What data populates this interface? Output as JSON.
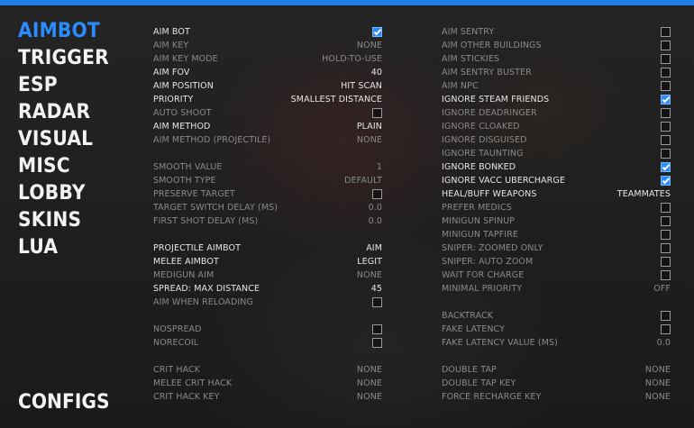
{
  "colors": {
    "accent": "#2a8cff",
    "topbar": "#1e7fe6"
  },
  "nav": {
    "items": [
      {
        "label": "AIMBOT",
        "active": true
      },
      {
        "label": "TRIGGER"
      },
      {
        "label": "ESP"
      },
      {
        "label": "RADAR"
      },
      {
        "label": "VISUAL"
      },
      {
        "label": "MISC"
      },
      {
        "label": "LOBBY"
      },
      {
        "label": "SKINS"
      },
      {
        "label": "LUA"
      }
    ],
    "configs_label": "CONFIGS"
  },
  "left": {
    "rows": [
      {
        "label": "AIM BOT",
        "type": "checkbox",
        "checked": true,
        "on": true
      },
      {
        "label": "AIM KEY",
        "type": "value",
        "value": "NONE"
      },
      {
        "label": "AIM KEY MODE",
        "type": "value",
        "value": "HOLD-TO-USE"
      },
      {
        "label": "AIM FOV",
        "type": "value",
        "value": "40",
        "on": true
      },
      {
        "label": "AIM POSITION",
        "type": "value",
        "value": "HIT SCAN",
        "on": true
      },
      {
        "label": "PRIORITY",
        "type": "value",
        "value": "SMALLEST DISTANCE",
        "on": true
      },
      {
        "label": "AUTO SHOOT",
        "type": "checkbox",
        "checked": false
      },
      {
        "label": "AIM METHOD",
        "type": "value",
        "value": "PLAIN",
        "on": true
      },
      {
        "label": "AIM METHOD (PROJECTILE)",
        "type": "value",
        "value": "NONE"
      },
      {
        "type": "gap"
      },
      {
        "label": "SMOOTH VALUE",
        "type": "value",
        "value": "1"
      },
      {
        "label": "SMOOTH TYPE",
        "type": "value",
        "value": "DEFAULT"
      },
      {
        "label": "PRESERVE TARGET",
        "type": "checkbox",
        "checked": false
      },
      {
        "label": "TARGET SWITCH DELAY (MS)",
        "type": "value",
        "value": "0.0"
      },
      {
        "label": "FIRST SHOT DELAY (MS)",
        "type": "value",
        "value": "0.0"
      },
      {
        "type": "gap"
      },
      {
        "label": "PROJECTILE AIMBOT",
        "type": "value",
        "value": "AIM",
        "on": true
      },
      {
        "label": "MELEE AIMBOT",
        "type": "value",
        "value": "LEGIT",
        "on": true
      },
      {
        "label": "MEDIGUN AIM",
        "type": "value",
        "value": "NONE"
      },
      {
        "label": "SPREAD: MAX DISTANCE",
        "type": "value",
        "value": "45",
        "on": true
      },
      {
        "label": "AIM WHEN RELOADING",
        "type": "checkbox",
        "checked": false
      },
      {
        "type": "gap"
      },
      {
        "label": "NOSPREAD",
        "type": "checkbox",
        "checked": false
      },
      {
        "label": "NORECOIL",
        "type": "checkbox",
        "checked": false
      },
      {
        "type": "gap"
      },
      {
        "label": "CRIT HACK",
        "type": "value",
        "value": "NONE"
      },
      {
        "label": "MELEE CRIT HACK",
        "type": "value",
        "value": "NONE"
      },
      {
        "label": "CRIT HACK KEY",
        "type": "value",
        "value": "NONE"
      }
    ]
  },
  "right": {
    "rows": [
      {
        "label": "AIM SENTRY",
        "type": "checkbox",
        "checked": false
      },
      {
        "label": "AIM OTHER BUILDINGS",
        "type": "checkbox",
        "checked": false
      },
      {
        "label": "AIM STICKIES",
        "type": "checkbox",
        "checked": false
      },
      {
        "label": "AIM SENTRY BUSTER",
        "type": "checkbox",
        "checked": false
      },
      {
        "label": "AIM NPC",
        "type": "checkbox",
        "checked": false
      },
      {
        "label": "IGNORE STEAM FRIENDS",
        "type": "checkbox",
        "checked": true,
        "on": true
      },
      {
        "label": "IGNORE DEADRINGER",
        "type": "checkbox",
        "checked": false
      },
      {
        "label": "IGNORE CLOAKED",
        "type": "checkbox",
        "checked": false
      },
      {
        "label": "IGNORE DISGUISED",
        "type": "checkbox",
        "checked": false
      },
      {
        "label": "IGNORE TAUNTING",
        "type": "checkbox",
        "checked": false
      },
      {
        "label": "IGNORE BONKED",
        "type": "checkbox",
        "checked": true,
        "on": true
      },
      {
        "label": "IGNORE VACC UBERCHARGE",
        "type": "checkbox",
        "checked": true,
        "on": true
      },
      {
        "label": "HEAL/BUFF WEAPONS",
        "type": "value",
        "value": "TEAMMATES",
        "on": true
      },
      {
        "label": "PREFER MEDICS",
        "type": "checkbox",
        "checked": false
      },
      {
        "label": "MINIGUN SPINUP",
        "type": "checkbox",
        "checked": false
      },
      {
        "label": "MINIGUN TAPFIRE",
        "type": "checkbox",
        "checked": false
      },
      {
        "label": "SNIPER: ZOOMED ONLY",
        "type": "checkbox",
        "checked": false
      },
      {
        "label": "SNIPER: AUTO ZOOM",
        "type": "checkbox",
        "checked": false
      },
      {
        "label": "WAIT FOR CHARGE",
        "type": "checkbox",
        "checked": false
      },
      {
        "label": "MINIMAL PRIORITY",
        "type": "value",
        "value": "OFF"
      },
      {
        "type": "gap"
      },
      {
        "label": "BACKTRACK",
        "type": "checkbox",
        "checked": false
      },
      {
        "label": "FAKE LATENCY",
        "type": "checkbox",
        "checked": false
      },
      {
        "label": "FAKE LATENCY VALUE (MS)",
        "type": "value",
        "value": "0.0"
      },
      {
        "type": "gap"
      },
      {
        "label": "DOUBLE TAP",
        "type": "value",
        "value": "NONE"
      },
      {
        "label": "DOUBLE TAP KEY",
        "type": "value",
        "value": "NONE"
      },
      {
        "label": "FORCE RECHARGE KEY",
        "type": "value",
        "value": "NONE"
      }
    ]
  }
}
